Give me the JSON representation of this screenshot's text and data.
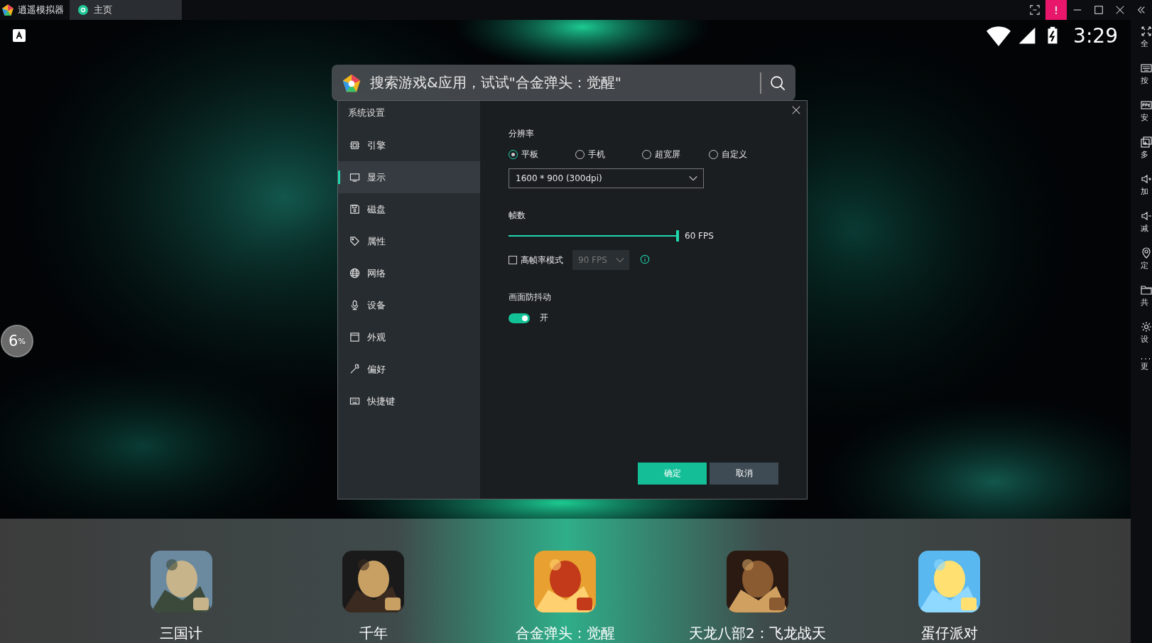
{
  "app_title": "逍遥模拟器",
  "tabs": [
    {
      "label": "主页",
      "selected": true
    }
  ],
  "status_bar": {
    "time": "3:29"
  },
  "side_toolbar": [
    {
      "label": "全"
    },
    {
      "label": "按"
    },
    {
      "label": "安"
    },
    {
      "label": "多"
    },
    {
      "label": "加"
    },
    {
      "label": "减"
    },
    {
      "label": "定"
    },
    {
      "label": "共"
    },
    {
      "label": "设"
    },
    {
      "label": "更"
    }
  ],
  "search": {
    "placeholder": "搜索游戏&应用，试试\"合金弹头：觉醒\""
  },
  "battery_widget": {
    "reading": "6$^{%}$"
  },
  "dialog": {
    "title": "系统设置",
    "nav": [
      {
        "label": "引擎",
        "selected": false
      },
      {
        "label": "显示",
        "selected": true
      },
      {
        "label": "磁盘",
        "selected": false
      },
      {
        "label": "属性",
        "selected": false
      },
      {
        "label": "网络",
        "selected": false
      },
      {
        "label": "设备",
        "selected": false
      },
      {
        "label": "外观",
        "selected": false
      },
      {
        "label": "偏好",
        "selected": false
      },
      {
        "label": "快捷键",
        "selected": false
      }
    ],
    "resolution": {
      "label": "分辨率",
      "options": [
        {
          "label": "平板",
          "selected": true
        },
        {
          "label": "手机",
          "selected": false
        },
        {
          "label": "超宽屏",
          "selected": false
        },
        {
          "label": "自定义",
          "selected": false
        }
      ],
      "value": "1600 * 900 (300dpi)"
    },
    "frame_rate": {
      "label": "帧数",
      "level": 1,
      "reading": "60 FPS"
    },
    "high_fps": {
      "label": "高帧率模式",
      "checked": false,
      "value": "90 FPS",
      "disabled": true
    },
    "stabilization": {
      "label": "画面防抖动",
      "on": true,
      "state_label": "开"
    },
    "buttons": [
      {
        "label": "确定",
        "kind": "primary"
      },
      {
        "label": "取消",
        "kind": "secondary"
      }
    ]
  },
  "dock": [
    {
      "label": "三国计"
    },
    {
      "label": "千年"
    },
    {
      "label": "合金弹头：觉醒"
    },
    {
      "label": "天龙八部2：飞龙战天"
    },
    {
      "label": "蛋仔派对"
    }
  ]
}
